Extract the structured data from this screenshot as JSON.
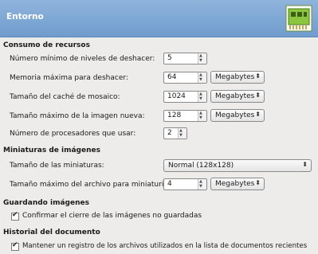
{
  "header": {
    "title": "Entorno"
  },
  "sections": {
    "resources": {
      "title": "Consumo de recursos",
      "undo_levels": {
        "label": "Número mínimo de niveles de deshacer:",
        "value": "5"
      },
      "undo_memory": {
        "label": "Memoria máxima para deshacer:",
        "value": "64",
        "unit": "Megabytes"
      },
      "tile_cache": {
        "label": "Tamaño del caché de mosaico:",
        "value": "1024",
        "unit": "Megabytes"
      },
      "new_image": {
        "label": "Tamaño máximo de la imagen nueva:",
        "value": "128",
        "unit": "Megabytes"
      },
      "processors": {
        "label": "Número de procesadores que usar:",
        "value": "2"
      }
    },
    "thumbnails": {
      "title": "Miniaturas de imágenes",
      "size": {
        "label": "Tamaño de las miniaturas:",
        "value": "Normal (128x128)"
      },
      "max_file": {
        "label": "Tamaño máximo del archivo para miniaturizar:",
        "value": "4",
        "unit": "Megabytes"
      }
    },
    "saving": {
      "title": "Guardando imágenes",
      "confirm_close": {
        "label": "Confirmar el cierre de las imágenes no guardadas",
        "checked": true
      }
    },
    "history": {
      "title": "Historial del documento",
      "keep_record": {
        "label": "Mantener un registro de los archivos utilizados en la lista de documentos recientes",
        "checked": true
      }
    }
  },
  "icons": {
    "header": "memory-chip-icon",
    "spin_up": "arrow-up-icon",
    "spin_down": "arrow-down-icon",
    "combo": "chevron-updown-icon",
    "check": "checkmark-icon"
  },
  "colors": {
    "header_bg": "#7ea6d4",
    "header_text": "#ffffff",
    "window_bg": "#edeceb"
  }
}
